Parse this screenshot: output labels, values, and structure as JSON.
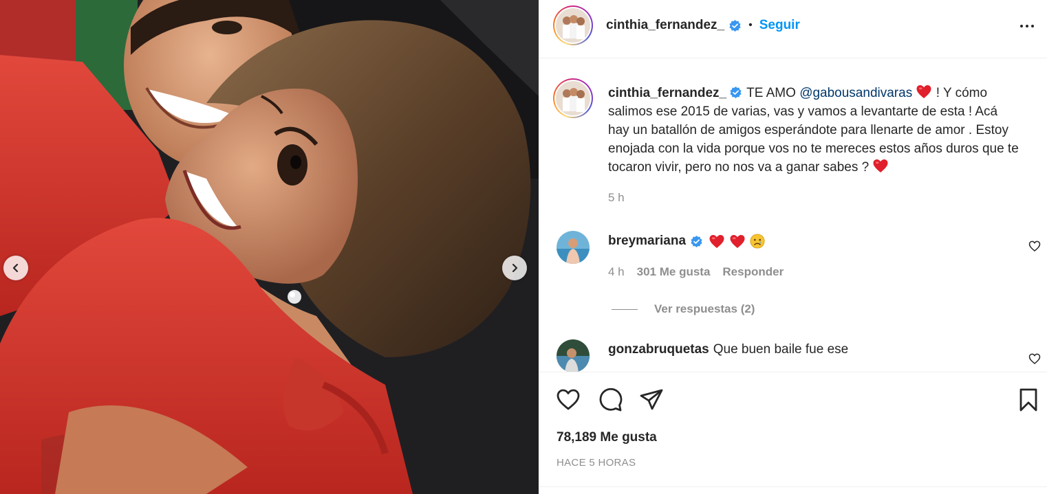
{
  "post": {
    "author": "cinthia_fernandez_",
    "verified": true,
    "follow_label": "Seguir",
    "separator": "•",
    "more_icon": "more-options-icon"
  },
  "caption": {
    "author": "cinthia_fernandez_",
    "text_1": "TE AMO",
    "mention": "@gabousandivaras",
    "text_2": "! Y cómo salimos ese 2015 de varias, vas y vamos a levantarte de esta ! Acá hay un batallón de amigos esperándote para llenarte de amor . Estoy enojada con la vida porque vos no te mereces estos años duros que te tocaron vivir, pero no nos va a ganar sabes ?",
    "time": "5 h"
  },
  "comments": [
    {
      "user": "breymariana",
      "verified": true,
      "text": "",
      "emoji": [
        "red-heart",
        "red-heart",
        "crying-face"
      ],
      "time": "4 h",
      "likes": "301 Me gusta",
      "reply_label": "Responder",
      "view_replies": "Ver respuestas (2)"
    },
    {
      "user": "gonzabruquetas",
      "verified": false,
      "text": "Que buen baile fue ese"
    }
  ],
  "actions": {
    "like_icon": "heart-outline-icon",
    "comment_icon": "comment-bubble-icon",
    "share_icon": "paper-plane-icon",
    "save_icon": "bookmark-icon"
  },
  "likes_count": "78,189 Me gusta",
  "posted_ago": "HACE 5 HORAS",
  "colors": {
    "accent": "#0095f6",
    "text": "#262626",
    "muted": "#8e8e8e",
    "heart": "#ed4956",
    "mention": "#00376b",
    "border": "#efefef"
  }
}
